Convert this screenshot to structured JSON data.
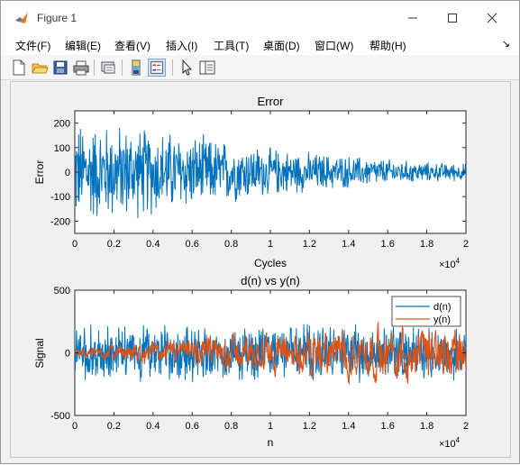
{
  "window": {
    "title": "Figure 1"
  },
  "menu": [
    {
      "label": "文件(F)"
    },
    {
      "label": "编辑(E)"
    },
    {
      "label": "查看(V)"
    },
    {
      "label": "插入(I)"
    },
    {
      "label": "工具(T)"
    },
    {
      "label": "桌面(D)"
    },
    {
      "label": "窗口(W)"
    },
    {
      "label": "帮助(H)"
    }
  ],
  "menu_overflow": "↘",
  "toolbar": [
    "new-figure-icon",
    "open-file-icon",
    "save-icon",
    "print-icon",
    "link-icon",
    "colorbar-icon",
    "legend-icon",
    "pointer-icon",
    "property-editor-icon"
  ],
  "colors": {
    "d_series": "#0072BD",
    "y_series": "#D95319"
  },
  "chart_data": [
    {
      "type": "line",
      "title": "Error",
      "xlabel": "Cycles",
      "ylabel": "Error",
      "xlim": [
        0,
        20000
      ],
      "ylim": [
        -250,
        250
      ],
      "xticks": [
        "0",
        "0.2",
        "0.4",
        "0.6",
        "0.8",
        "1",
        "1.2",
        "1.4",
        "1.6",
        "1.8",
        "2"
      ],
      "xtick_multiplier": "×10^4",
      "xtick_multiplier_base": "×10",
      "xtick_multiplier_exp": "4",
      "yticks": [
        "-200",
        "-100",
        "0",
        "100",
        "200"
      ],
      "series": [
        {
          "envelope_x": [
            0,
            2000,
            4000,
            6000,
            8000,
            10000,
            12000,
            14000,
            16000,
            18000,
            20000
          ],
          "envelope_amplitude": [
            230,
            220,
            200,
            170,
            140,
            110,
            90,
            75,
            60,
            45,
            40
          ]
        }
      ]
    },
    {
      "type": "line",
      "title": "d(n) vs y(n)",
      "xlabel": "n",
      "ylabel": "Signal",
      "xlim": [
        0,
        20000
      ],
      "ylim": [
        -500,
        500
      ],
      "xticks": [
        "0",
        "0.2",
        "0.4",
        "0.6",
        "0.8",
        "1",
        "1.2",
        "1.4",
        "1.6",
        "1.8",
        "2"
      ],
      "xtick_multiplier": "×10^4",
      "xtick_multiplier_base": "×10",
      "xtick_multiplier_exp": "4",
      "yticks": [
        "-500",
        "0",
        "500"
      ],
      "legend": {
        "placement": "top-right",
        "entries": [
          "d(n)",
          "y(n)"
        ]
      },
      "series": [
        {
          "name": "d(n)",
          "envelope_amplitude_approx": 250
        },
        {
          "name": "y(n)",
          "envelope_x": [
            0,
            4000,
            8000,
            12000,
            16000,
            20000
          ],
          "envelope_amplitude": [
            30,
            60,
            100,
            130,
            150,
            160
          ]
        }
      ]
    }
  ]
}
